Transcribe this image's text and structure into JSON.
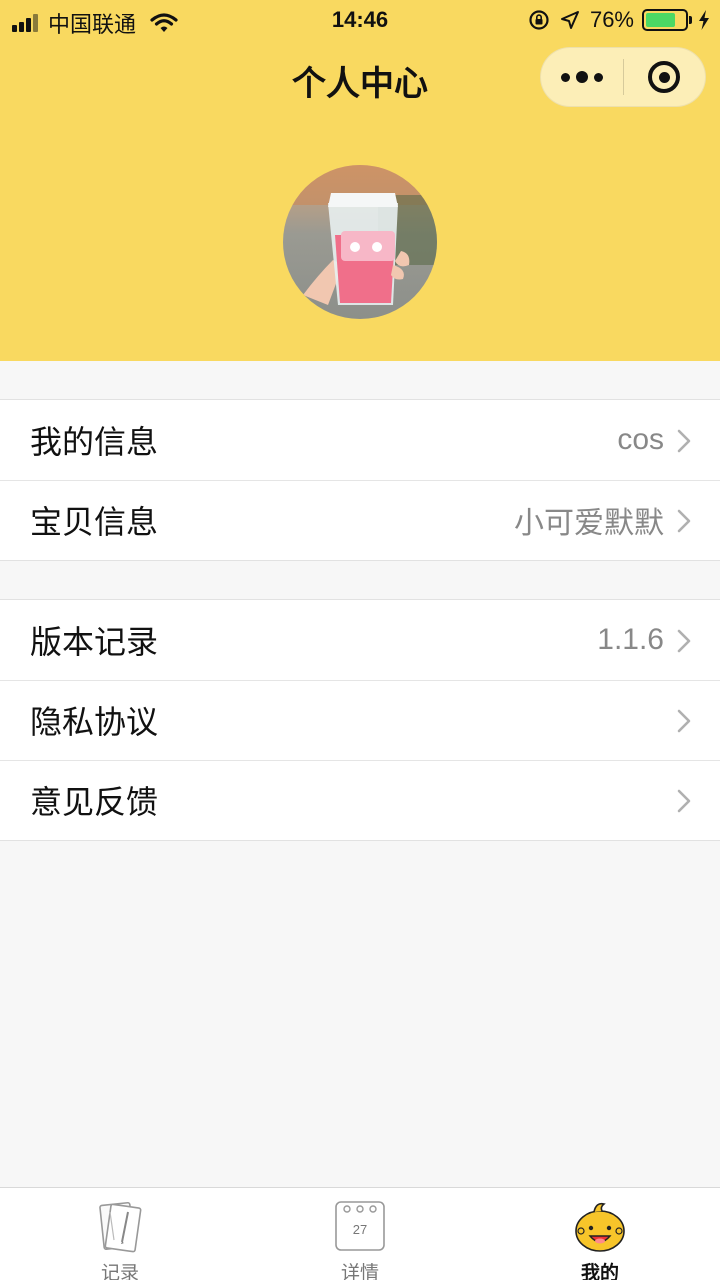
{
  "status_bar": {
    "carrier": "中国联通",
    "time": "14:46",
    "battery_percent": "76%",
    "battery_level": 0.76
  },
  "nav": {
    "title": "个人中心"
  },
  "groups": [
    {
      "rows": [
        {
          "label": "我的信息",
          "value": "cos"
        },
        {
          "label": "宝贝信息",
          "value": "小可爱默默"
        }
      ]
    },
    {
      "rows": [
        {
          "label": "版本记录",
          "value": "1.1.6"
        },
        {
          "label": "隐私协议",
          "value": ""
        },
        {
          "label": "意见反馈",
          "value": ""
        }
      ]
    }
  ],
  "tabbar": {
    "tabs": [
      {
        "label": "记录",
        "icon": "notebook-icon"
      },
      {
        "label": "详情",
        "icon": "calendar-icon",
        "calendar_day": "27"
      },
      {
        "label": "我的",
        "icon": "baby-face-icon"
      }
    ],
    "active_index": 2
  },
  "colors": {
    "header_bg": "#f9d960",
    "page_bg": "#f7f7f7",
    "battery_green": "#4cd964"
  }
}
